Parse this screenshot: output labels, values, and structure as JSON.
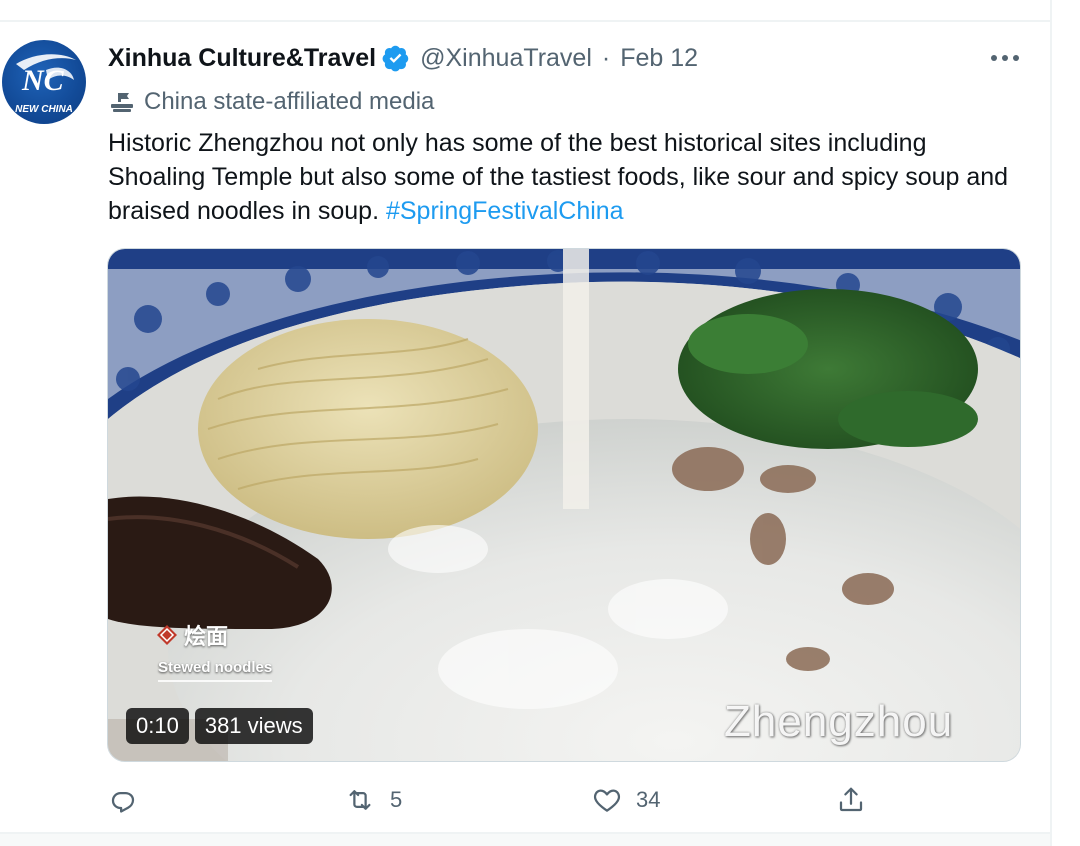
{
  "tweet": {
    "display_name": "Xinhua Culture&Travel",
    "verified_icon": "verified-badge-icon",
    "handle": "@XinhuaTravel",
    "separator": "·",
    "date": "Feb 12",
    "affiliation_label": "China state-affiliated media",
    "text_main": "Historic Zhengzhou not only has some of the best historical sites including Shoaling Temple but also some of the tastiest foods, like sour and spicy soup and braised noodles in soup. ",
    "hashtag": "#SpringFestivalChina",
    "avatar": {
      "logo_text": "NEW CHINA",
      "logo_initials": "NC"
    }
  },
  "media": {
    "type": "video",
    "caption_zh": "烩面",
    "caption_en": "Stewed noodles",
    "watermark": "Zhengzhou",
    "duration": "0:10",
    "views": "381 views"
  },
  "actions": {
    "reply_count": "",
    "retweet_count": "5",
    "like_count": "34",
    "share_label": ""
  },
  "colors": {
    "accent": "#1d9bf0",
    "text_primary": "#0f1419",
    "text_secondary": "#536471",
    "divider": "#eff3f4"
  }
}
